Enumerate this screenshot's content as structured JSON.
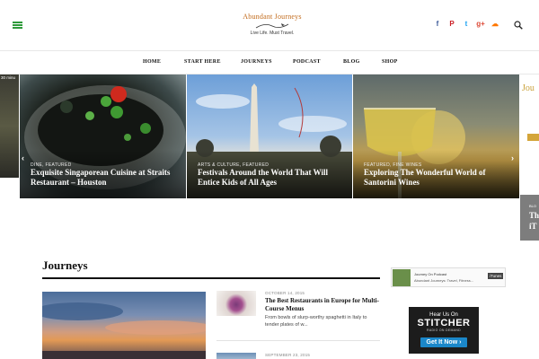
{
  "header": {
    "logo_name": "Abundant Journeys",
    "logo_tagline": "Live Life. Must Travel.",
    "social": [
      {
        "icon": "facebook-icon",
        "glyph": "f",
        "color": "#3b5998"
      },
      {
        "icon": "pinterest-icon",
        "glyph": "P",
        "color": "#cb2027"
      },
      {
        "icon": "twitter-icon",
        "glyph": "t",
        "color": "#1da1f2"
      },
      {
        "icon": "google-plus-icon",
        "glyph": "g+",
        "color": "#dd4b39"
      },
      {
        "icon": "soundcloud-icon",
        "glyph": "☁",
        "color": "#ff7700"
      }
    ]
  },
  "nav": {
    "items": [
      "HOME",
      "START HERE",
      "JOURNEYS",
      "PODCAST",
      "BLOG",
      "SHOP"
    ]
  },
  "slider": {
    "left_peek_text": "30 minu",
    "right_peek_text": "Jou",
    "right_peek_cat": "BLO",
    "right_peek_title_1": "Th",
    "right_peek_title_2": "iT",
    "slides": [
      {
        "category": "DINE, FEATURED",
        "title": "Exquisite Singaporean Cuisine at Straits Restaurant – Houston"
      },
      {
        "category": "ARTS & CULTURE, FEATURED",
        "title": "Festivals Around the World That Will Entice Kids of All Ages"
      },
      {
        "category": "FEATURED, FINE WINES",
        "title": "Exploring The Wonderful World of Santorini Wines"
      }
    ]
  },
  "journeys": {
    "section_title": "Journeys",
    "posts": [
      {
        "date": "OCTOBER 14, 2015",
        "title": "The Best Restaurants in Europe for Multi-Course Menus",
        "excerpt": "From bowls of slurp-worthy spaghetti in Italy to tender plates of w..."
      },
      {
        "date": "SEPTEMBER 23, 2015",
        "title": "",
        "excerpt": ""
      }
    ]
  },
  "sidebar": {
    "podcast_line1": "Journey On Podcast",
    "podcast_line2": "Abundant Journeys: Travel, Fitness...",
    "itunes_label": "iTunes",
    "stitcher_hear": "Hear Us On",
    "stitcher_name": "STITCHER",
    "stitcher_sub": "RADIO ON DEMAND",
    "stitcher_cta": "Get It Now ›"
  }
}
